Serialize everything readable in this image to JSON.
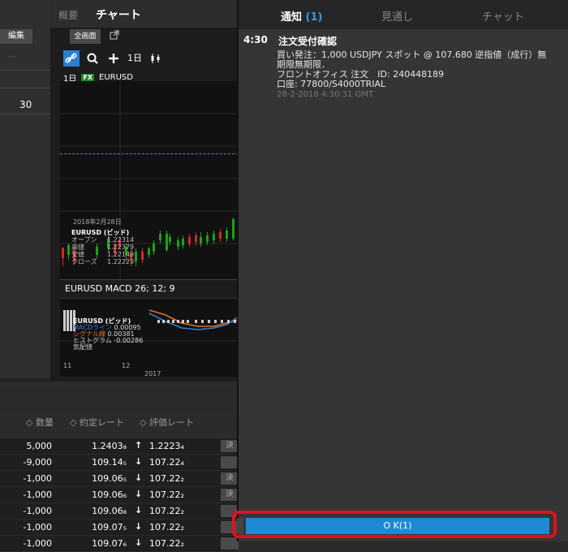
{
  "left_panel": {
    "edit_label": "編集",
    "dots": "...",
    "value": "30"
  },
  "chart": {
    "tabs": [
      "概要",
      "チャート"
    ],
    "fullscreen_label": "全画面",
    "popout_icon": "external-link-icon",
    "toolbar": {
      "link_icon": "link-icon",
      "search_icon": "search-icon",
      "add_icon": "plus-icon",
      "timeframe": "1日",
      "candle_icon": "candlestick-icon"
    },
    "timeframe_label": "1日",
    "fx_badge": "FX",
    "instrument": "EURUSD",
    "date": "2018年2月28日",
    "ohlc_title": "EURUSD (ビッド)",
    "ohlc": [
      {
        "label": "オープン",
        "value": "1.22314"
      },
      {
        "label": "高値",
        "value": "1.22379"
      },
      {
        "label": "安値",
        "value": "1.22149"
      },
      {
        "label": "クローズ",
        "value": "1.22229"
      }
    ],
    "macd_title": "EURUSD MACD 26; 12; 9",
    "macd_legend_title": "EURUSD (ビッド)",
    "macd_legend": [
      {
        "label": "MACDライン",
        "value": "0.00095",
        "color": "#3a78d4"
      },
      {
        "label": "シグナル線",
        "value": "0.00381",
        "color": "#e0702a"
      },
      {
        "label": "ヒストグラム",
        "value": "-0.00286",
        "color": "#cccccc"
      },
      {
        "label": "気配値",
        "value": "",
        "color": "#cccccc"
      }
    ],
    "ticks": [
      "11",
      "12"
    ],
    "year": "2017",
    "colors": {
      "up": "#19a319",
      "down": "#d4262b",
      "dash": "#4a8fd1"
    }
  },
  "positions": {
    "headers": [
      "◇ 数量",
      "◇ 約定レート",
      "◇ 評価レート"
    ],
    "rows": [
      {
        "qty": "5,000",
        "rate": "1.2403₈",
        "dir": "↑",
        "eval": "1.2223₄",
        "btn": "決"
      },
      {
        "qty": "-9,000",
        "rate": "109.14₅",
        "dir": "↓",
        "eval": "107.22₄",
        "btn": ""
      },
      {
        "qty": "-1,000",
        "rate": "109.06₅",
        "dir": "↓",
        "eval": "107.22₂",
        "btn": "決"
      },
      {
        "qty": "-1,000",
        "rate": "109.06₆",
        "dir": "↓",
        "eval": "107.22₂",
        "btn": "決"
      },
      {
        "qty": "-1,000",
        "rate": "109.06₈",
        "dir": "↓",
        "eval": "107.22₂",
        "btn": ""
      },
      {
        "qty": "-1,000",
        "rate": "109.07₅",
        "dir": "↓",
        "eval": "107.22₂",
        "btn": ""
      },
      {
        "qty": "-1,000",
        "rate": "109.07₆",
        "dir": "↓",
        "eval": "107.22₂",
        "btn": ""
      }
    ]
  },
  "notifications": {
    "tabs": {
      "notice": "通知",
      "notice_count": "(1)",
      "outlook": "見通し",
      "chat": "チャット"
    },
    "item": {
      "time": "4:30",
      "title": "注文受付確認",
      "body_line1": "買い発注：1,000 USDJPY スポット @ 107.680 逆指値（成行）無期限無期限．",
      "body_line2": "フロントオフィス 注文　ID: 240448189",
      "body_line3": "口座: 77800/S4000TRIAL",
      "timestamp": "28-2-2018 4:30:31 GMT"
    },
    "ok_label": "O K(1)",
    "highlight_color": "#e1101f"
  }
}
